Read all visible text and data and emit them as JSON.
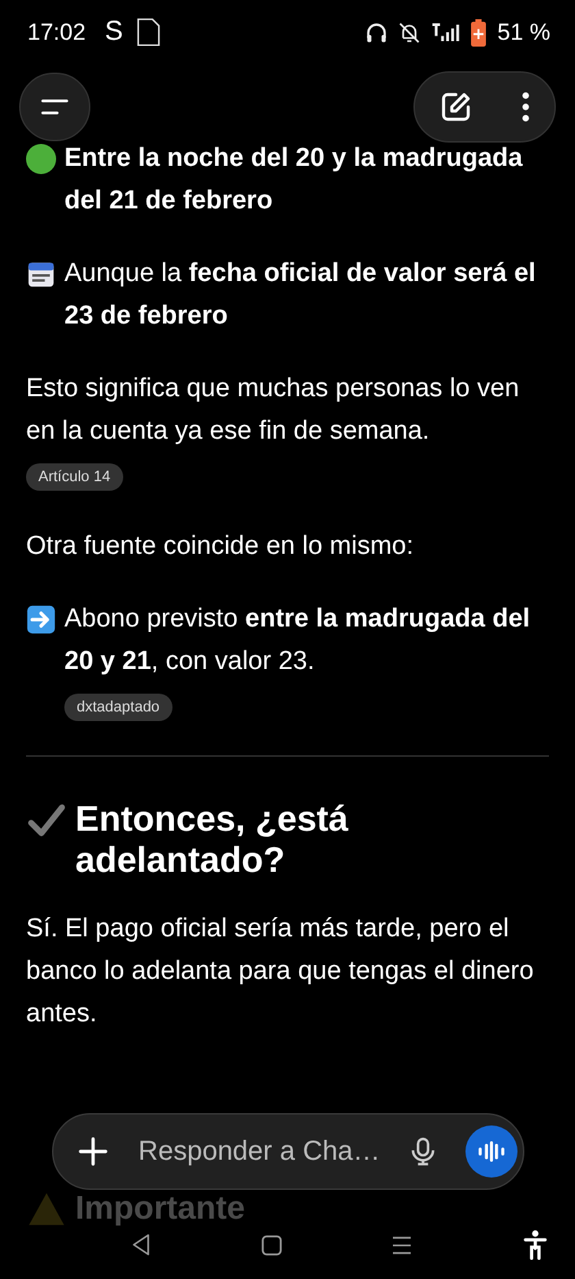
{
  "status_bar": {
    "time": "17:02",
    "carrier": "S",
    "battery": "51 %"
  },
  "blocks": [
    {
      "kind": "dot",
      "text": "**Entre la noche del 20 y la madrugada del 21 de febrero**"
    },
    {
      "kind": "calendar",
      "text": "Aunque la **fecha oficial de valor será el 23 de febrero**"
    },
    {
      "kind": "plain",
      "text": "Esto significa que muchas personas lo ven en la cuenta ya ese fin de semana.",
      "source": "Artículo 14"
    },
    {
      "kind": "plain",
      "text": "Otra fuente coincide en lo mismo:"
    },
    {
      "kind": "arrow",
      "text": "Abono previsto **entre la madrugada del 20 y 21**, con valor 23.",
      "source": "dxtadaptado"
    },
    {
      "kind": "rule"
    },
    {
      "kind": "heading",
      "text": "Entonces, ¿está adelantado?"
    },
    {
      "kind": "plain",
      "text": "Sí. El pago oficial sería más tarde, pero el banco lo adelanta para que tengas el dinero antes."
    }
  ],
  "faded_bottom": "Importante",
  "composer": {
    "placeholder": "Responder a Cha…"
  }
}
